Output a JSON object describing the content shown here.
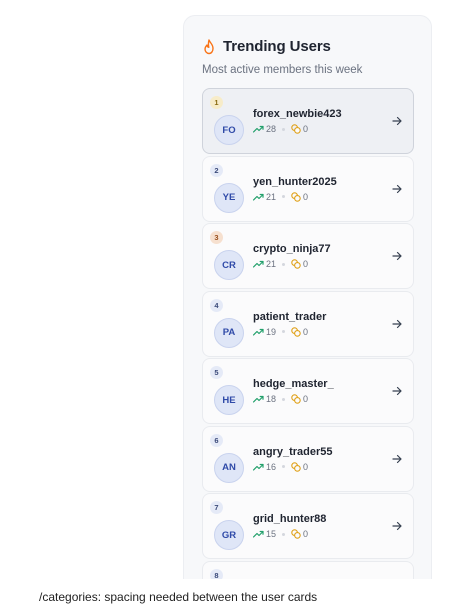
{
  "panel": {
    "title": "Trending Users",
    "subtitle": "Most active members this week"
  },
  "users": [
    {
      "rank": "1",
      "initials": "FO",
      "name": "forex_newbie423",
      "trend": "28",
      "categories": "0"
    },
    {
      "rank": "2",
      "initials": "YE",
      "name": "yen_hunter2025",
      "trend": "21",
      "categories": "0"
    },
    {
      "rank": "3",
      "initials": "CR",
      "name": "crypto_ninja77",
      "trend": "21",
      "categories": "0"
    },
    {
      "rank": "4",
      "initials": "PA",
      "name": "patient_trader",
      "trend": "19",
      "categories": "0"
    },
    {
      "rank": "5",
      "initials": "HE",
      "name": "hedge_master_",
      "trend": "18",
      "categories": "0"
    },
    {
      "rank": "6",
      "initials": "AN",
      "name": "angry_trader55",
      "trend": "16",
      "categories": "0"
    },
    {
      "rank": "7",
      "initials": "GR",
      "name": "grid_hunter88",
      "trend": "15",
      "categories": "0"
    },
    {
      "rank": "8",
      "initials": "",
      "name": "",
      "trend": "",
      "categories": ""
    }
  ],
  "colors": {
    "accent_flame": "#f97316",
    "trend_green": "#22a06b",
    "category_amber": "#e0a21b",
    "avatar_text": "#2f4aa8"
  },
  "icons": {
    "header": "flame-icon",
    "trend": "trending-up-icon",
    "categories": "coins-icon",
    "row_action": "arrow-right-icon"
  },
  "note": "/categories: spacing needed between the user cards"
}
